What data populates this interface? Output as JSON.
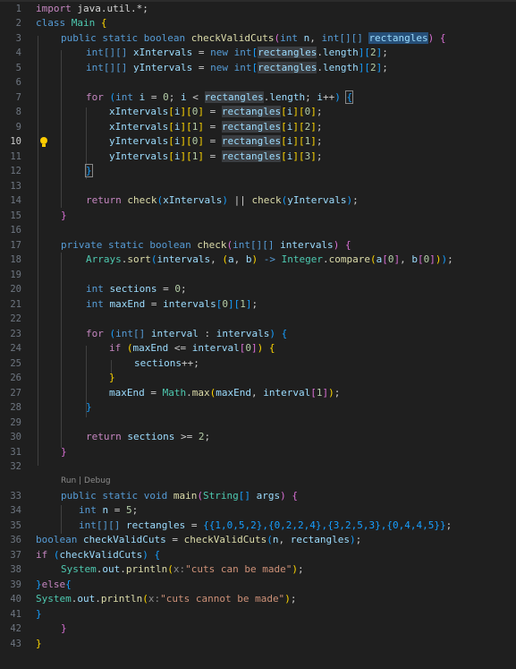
{
  "gutter": {
    "line_numbers": [
      "1",
      "2",
      "3",
      "4",
      "5",
      "6",
      "7",
      "8",
      "9",
      "10",
      "11",
      "12",
      "13",
      "14",
      "15",
      "16",
      "17",
      "18",
      "19",
      "20",
      "21",
      "22",
      "23",
      "24",
      "25",
      "26",
      "27",
      "28",
      "29",
      "30",
      "31",
      "32",
      "33",
      "34",
      "35",
      "36",
      "37",
      "38",
      "39",
      "40",
      "41",
      "42",
      "43"
    ],
    "active_line": "10"
  },
  "codelens": {
    "run": "Run",
    "separator": " | ",
    "debug": "Debug"
  },
  "code": {
    "import_kw": "import",
    "import_pkg": "java.util.*;",
    "class_kw": "class",
    "class_name": "Main",
    "public_kw": "public",
    "private_kw": "private",
    "static_kw": "static",
    "boolean_kw": "boolean",
    "void_kw": "void",
    "int_kw": "int",
    "int_arr": "int[][]",
    "int_1d": "int[]",
    "new_kw": "new",
    "for_kw": "for",
    "if_kw": "if",
    "return_kw": "return",
    "else_kw": "else",
    "m_checkValidCuts": "checkValidCuts",
    "m_check": "check",
    "m_main": "main",
    "m_sort": "sort",
    "m_compare": "compare",
    "m_max": "max",
    "m_println": "println",
    "p_n": "n",
    "p_rectangles": "rectangles",
    "p_intervals": "intervals",
    "v_xIntervals": "xIntervals",
    "v_yIntervals": "yIntervals",
    "v_i": "i",
    "v_length": "length",
    "v_sections": "sections",
    "v_maxEnd": "maxEnd",
    "v_interval": "interval",
    "v_args": "args",
    "v_a": "a",
    "v_b": "b",
    "v_x": "x",
    "v_checkValidCuts": "checkValidCuts",
    "t_Arrays": "Arrays",
    "t_Integer": "Integer",
    "t_Math": "Math",
    "t_String": "String",
    "t_System": "System",
    "v_out": "out",
    "n0": "0",
    "n1": "1",
    "n2": "2",
    "n3": "3",
    "n5": "5",
    "rect_literal": "{{1,0,5,2},{0,2,2,4},{3,2,5,3},{0,4,4,5}}",
    "str_yes": "\"cuts can be made\"",
    "str_no": "\"cuts cannot be made\""
  },
  "colors": {
    "background": "#1f1f1f",
    "keyword": "#569cd6",
    "control": "#c586c0",
    "type": "#4ec9b0",
    "function": "#dcdcaa",
    "variable": "#9cdcfe",
    "number": "#b5cea8",
    "string": "#ce9178"
  }
}
